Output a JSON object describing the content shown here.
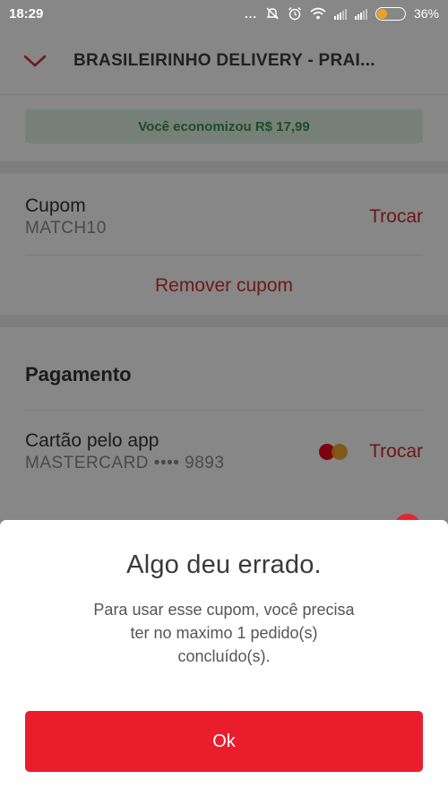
{
  "status_bar": {
    "time": "18:29",
    "dots": "...",
    "battery_percent": "36%",
    "battery_level": 0.36,
    "icons": [
      "mute-icon",
      "alarm-icon",
      "wifi-icon",
      "signal-icon",
      "signal-icon",
      "battery-icon"
    ]
  },
  "header": {
    "title": "BRASILEIRINHO DELIVERY - PRAI...",
    "back_icon": "chevron-down-icon"
  },
  "savings": {
    "text": "Você economizou R$ 17,99"
  },
  "coupon": {
    "label": "Cupom",
    "code": "MATCH10",
    "change_label": "Trocar",
    "remove_label": "Remover cupom"
  },
  "payment": {
    "title": "Pagamento",
    "method_label": "Cartão pelo app",
    "card_text": "MASTERCARD •••• 9893",
    "change_label": "Trocar",
    "card_icon": "mastercard-icon"
  },
  "dialog": {
    "title": "Algo deu errado.",
    "message": "Para usar esse cupom, você precisa ter no maximo 1 pedido(s) concluído(s).",
    "ok_label": "Ok"
  },
  "colors": {
    "accent": "#ea1d2c",
    "link_red": "#c9302c",
    "savings_bg": "#dff1e4",
    "savings_text": "#3c8f52"
  }
}
